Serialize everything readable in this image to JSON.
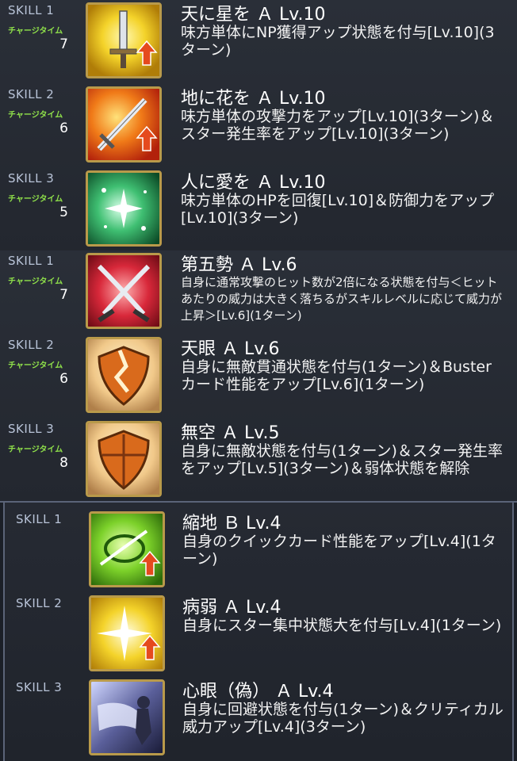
{
  "groups": [
    {
      "skills": [
        {
          "label": "SKILL 1",
          "ct_label": "チャージタイム",
          "ct": "7",
          "icon": "sword-up-icon",
          "name": "天に星を Ａ Lv.10",
          "desc": "味方単体にNP獲得アップ状態を付与[Lv.10](3ターン)"
        },
        {
          "label": "SKILL 2",
          "ct_label": "チャージタイム",
          "ct": "6",
          "icon": "sword-attack-up-icon",
          "name": "地に花を Ａ Lv.10",
          "desc": "味方単体の攻撃力をアップ[Lv.10](3ターン)＆スター発生率をアップ[Lv.10](3ターン)"
        },
        {
          "label": "SKILL 3",
          "ct_label": "チャージタイム",
          "ct": "5",
          "icon": "sparkle-heal-icon",
          "name": "人に愛を Ａ Lv.10",
          "desc": "味方単体のHPを回復[Lv.10]＆防御力をアップ[Lv.10](3ターン)"
        }
      ]
    },
    {
      "skills": [
        {
          "label": "SKILL 1",
          "ct_label": "チャージタイム",
          "ct": "7",
          "icon": "crossed-swords-icon",
          "name": "第五勢 Ａ Lv.6",
          "desc": "自身に通常攻撃のヒット数が2倍になる状態を付与＜ヒットあたりの威力は大きく落ちるがスキルレベルに応じて威力が上昇＞[Lv.6](1ターン)"
        },
        {
          "label": "SKILL 2",
          "ct_label": "チャージタイム",
          "ct": "6",
          "icon": "broken-shield-icon",
          "name": "天眼 Ａ Lv.6",
          "desc": "自身に無敵貫通状態を付与(1ターン)＆Busterカード性能をアップ[Lv.6](1ターン)"
        },
        {
          "label": "SKILL 3",
          "ct_label": "チャージタイム",
          "ct": "8",
          "icon": "shield-icon",
          "name": "無空 Ａ Lv.5",
          "desc": "自身に無敵状態を付与(1ターン)＆スター発生率をアップ[Lv.5](3ターン)＆弱体状態を解除"
        }
      ]
    },
    {
      "skills": [
        {
          "label": "SKILL 1",
          "ct_label": "",
          "ct": "",
          "icon": "quick-up-icon",
          "name": "縮地 Ｂ Lv.4",
          "desc": "自身のクイックカード性能をアップ[Lv.4](1ターン)"
        },
        {
          "label": "SKILL 2",
          "ct_label": "",
          "ct": "",
          "icon": "star-up-icon",
          "name": "病弱 Ａ Lv.4",
          "desc": "自身にスター集中状態大を付与[Lv.4](1ターン)"
        },
        {
          "label": "SKILL 3",
          "ct_label": "",
          "ct": "",
          "icon": "mind-eye-icon",
          "name": "心眼（偽） Ａ Lv.4",
          "desc": "自身に回避状態を付与(1ターン)＆クリティカル威力アップ[Lv.4](3ターン)"
        }
      ]
    }
  ]
}
